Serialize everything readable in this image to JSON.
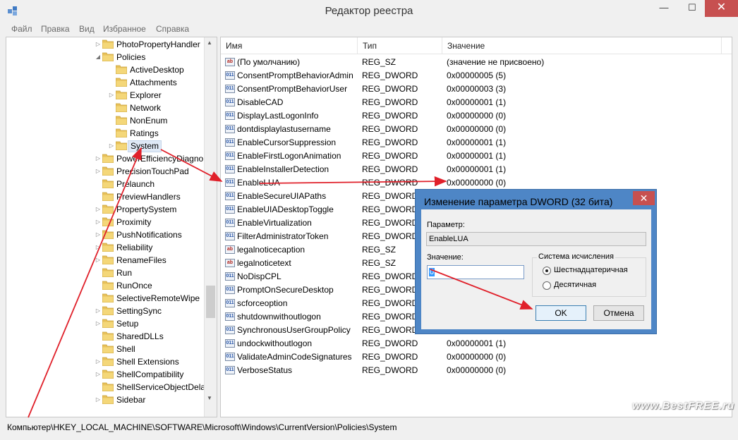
{
  "window": {
    "title": "Редактор реестра",
    "minimize": "—",
    "maximize": "☐",
    "close": "✕"
  },
  "menu": [
    "Файл",
    "Правка",
    "Вид",
    "Избранное",
    "Справка"
  ],
  "tree": [
    {
      "label": "PhotoPropertyHandler",
      "exp": "▷"
    },
    {
      "label": "Policies",
      "exp": "◢"
    },
    {
      "label": "ActiveDesktop",
      "exp": ""
    },
    {
      "label": "Attachments",
      "exp": ""
    },
    {
      "label": "Explorer",
      "exp": "▷"
    },
    {
      "label": "Network",
      "exp": ""
    },
    {
      "label": "NonEnum",
      "exp": ""
    },
    {
      "label": "Ratings",
      "exp": ""
    },
    {
      "label": "System",
      "exp": "▷"
    },
    {
      "label": "PowerEfficiencyDiagno",
      "exp": "▷"
    },
    {
      "label": "PrecisionTouchPad",
      "exp": "▷"
    },
    {
      "label": "Prelaunch",
      "exp": ""
    },
    {
      "label": "PreviewHandlers",
      "exp": ""
    },
    {
      "label": "PropertySystem",
      "exp": "▷"
    },
    {
      "label": "Proximity",
      "exp": "▷"
    },
    {
      "label": "PushNotifications",
      "exp": "▷"
    },
    {
      "label": "Reliability",
      "exp": "▷"
    },
    {
      "label": "RenameFiles",
      "exp": "▷"
    },
    {
      "label": "Run",
      "exp": ""
    },
    {
      "label": "RunOnce",
      "exp": ""
    },
    {
      "label": "SelectiveRemoteWipe",
      "exp": ""
    },
    {
      "label": "SettingSync",
      "exp": "▷"
    },
    {
      "label": "Setup",
      "exp": "▷"
    },
    {
      "label": "SharedDLLs",
      "exp": ""
    },
    {
      "label": "Shell",
      "exp": ""
    },
    {
      "label": "Shell Extensions",
      "exp": "▷"
    },
    {
      "label": "ShellCompatibility",
      "exp": "▷"
    },
    {
      "label": "ShellServiceObjectDelay",
      "exp": ""
    },
    {
      "label": "Sidebar",
      "exp": "▷"
    }
  ],
  "columns": {
    "name": "Имя",
    "type": "Тип",
    "value": "Значение"
  },
  "rows": [
    {
      "icon": "ab",
      "name": "(По умолчанию)",
      "type": "REG_SZ",
      "value": "(значение не присвоено)"
    },
    {
      "icon": "dw",
      "name": "ConsentPromptBehaviorAdmin",
      "type": "REG_DWORD",
      "value": "0x00000005 (5)"
    },
    {
      "icon": "dw",
      "name": "ConsentPromptBehaviorUser",
      "type": "REG_DWORD",
      "value": "0x00000003 (3)"
    },
    {
      "icon": "dw",
      "name": "DisableCAD",
      "type": "REG_DWORD",
      "value": "0x00000001 (1)"
    },
    {
      "icon": "dw",
      "name": "DisplayLastLogonInfo",
      "type": "REG_DWORD",
      "value": "0x00000000 (0)"
    },
    {
      "icon": "dw",
      "name": "dontdisplaylastusername",
      "type": "REG_DWORD",
      "value": "0x00000000 (0)"
    },
    {
      "icon": "dw",
      "name": "EnableCursorSuppression",
      "type": "REG_DWORD",
      "value": "0x00000001 (1)"
    },
    {
      "icon": "dw",
      "name": "EnableFirstLogonAnimation",
      "type": "REG_DWORD",
      "value": "0x00000001 (1)"
    },
    {
      "icon": "dw",
      "name": "EnableInstallerDetection",
      "type": "REG_DWORD",
      "value": "0x00000001 (1)"
    },
    {
      "icon": "dw",
      "name": "EnableLUA",
      "type": "REG_DWORD",
      "value": "0x00000000 (0)"
    },
    {
      "icon": "dw",
      "name": "EnableSecureUIAPaths",
      "type": "REG_DWORD",
      "value": ""
    },
    {
      "icon": "dw",
      "name": "EnableUIADesktopToggle",
      "type": "REG_DWORD",
      "value": ""
    },
    {
      "icon": "dw",
      "name": "EnableVirtualization",
      "type": "REG_DWORD",
      "value": ""
    },
    {
      "icon": "dw",
      "name": "FilterAdministratorToken",
      "type": "REG_DWORD",
      "value": ""
    },
    {
      "icon": "ab",
      "name": "legalnoticecaption",
      "type": "REG_SZ",
      "value": ""
    },
    {
      "icon": "ab",
      "name": "legalnoticetext",
      "type": "REG_SZ",
      "value": ""
    },
    {
      "icon": "dw",
      "name": "NoDispCPL",
      "type": "REG_DWORD",
      "value": ""
    },
    {
      "icon": "dw",
      "name": "PromptOnSecureDesktop",
      "type": "REG_DWORD",
      "value": ""
    },
    {
      "icon": "dw",
      "name": "scforceoption",
      "type": "REG_DWORD",
      "value": ""
    },
    {
      "icon": "dw",
      "name": "shutdownwithoutlogon",
      "type": "REG_DWORD",
      "value": ""
    },
    {
      "icon": "dw",
      "name": "SynchronousUserGroupPolicy",
      "type": "REG_DWORD",
      "value": ""
    },
    {
      "icon": "dw",
      "name": "undockwithoutlogon",
      "type": "REG_DWORD",
      "value": "0x00000001 (1)"
    },
    {
      "icon": "dw",
      "name": "ValidateAdminCodeSignatures",
      "type": "REG_DWORD",
      "value": "0x00000000 (0)"
    },
    {
      "icon": "dw",
      "name": "VerboseStatus",
      "type": "REG_DWORD",
      "value": "0x00000000 (0)"
    }
  ],
  "status": "Компьютер\\HKEY_LOCAL_MACHINE\\SOFTWARE\\Microsoft\\Windows\\CurrentVersion\\Policies\\System",
  "watermark": "www.BestFREE.ru",
  "dialog": {
    "title": "Изменение параметра DWORD (32 бита)",
    "close": "✕",
    "param_label": "Параметр:",
    "param_value": "EnableLUA",
    "value_label": "Значение:",
    "value": "0",
    "base_label": "Система исчисления",
    "hex_label": "Шестнадцатеричная",
    "dec_label": "Десятичная",
    "selected_base": "hex",
    "ok": "OK",
    "cancel": "Отмена"
  },
  "colors": {
    "accent": "#4e86c6",
    "annotation": "#e0202a",
    "close": "#c75050"
  }
}
